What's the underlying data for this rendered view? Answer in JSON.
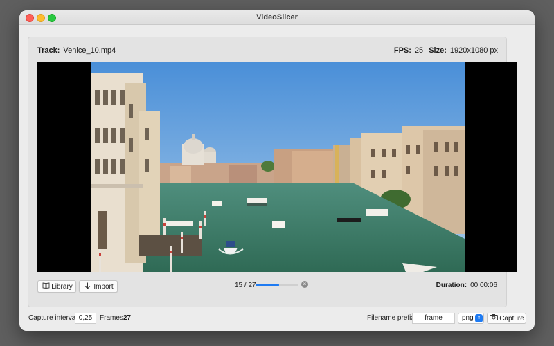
{
  "window": {
    "title": "VideoSlicer"
  },
  "header": {
    "track_label": "Track:",
    "track_value": "Venice_10.mp4",
    "fps_label": "FPS:",
    "fps_value": "25",
    "size_label": "Size:",
    "size_value": "1920x1080 px"
  },
  "player": {
    "library_label": "Library",
    "import_label": "Import",
    "frame_counter": "15 / 27",
    "progress": 0.5556,
    "duration_label": "Duration:",
    "duration_value": "00:00:06"
  },
  "capture": {
    "interval_label": "Capture interval:",
    "interval_value": "0,25",
    "frames_label": "Frames:",
    "frames_value": "27",
    "prefix_label": "Filename prefix:",
    "prefix_value": "frame",
    "format_value": "png",
    "capture_label": "Capture"
  },
  "icons": {
    "library": "book-icon",
    "import": "arrow-down-icon",
    "clear": "clear-circle-icon",
    "format": "chevron-updown-icon",
    "capture": "camera-icon"
  },
  "colors": {
    "accent": "#1f7bf2",
    "video_bg": "#000000",
    "window_bg": "#ececec"
  }
}
